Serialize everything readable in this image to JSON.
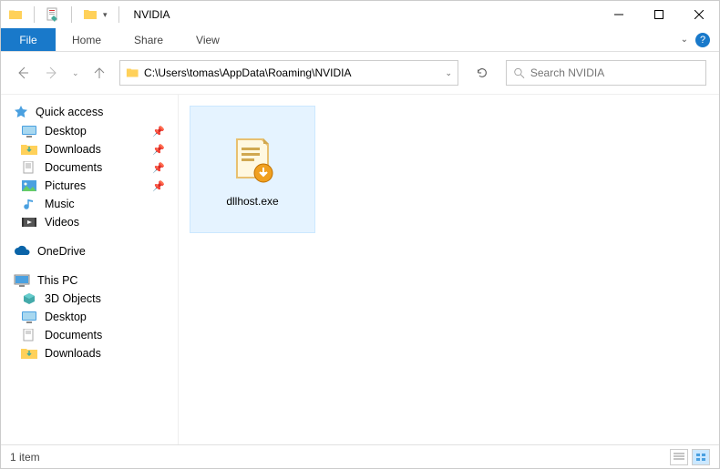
{
  "window": {
    "title": "NVIDIA"
  },
  "ribbon": {
    "file_tab": "File",
    "tabs": [
      "Home",
      "Share",
      "View"
    ]
  },
  "nav": {
    "address_path": "C:\\Users\\tomas\\AppData\\Roaming\\NVIDIA",
    "search_placeholder": "Search NVIDIA"
  },
  "sidebar": {
    "quick_access": {
      "label": "Quick access",
      "items": [
        {
          "label": "Desktop",
          "pinned": true,
          "icon": "desktop"
        },
        {
          "label": "Downloads",
          "pinned": true,
          "icon": "downloads"
        },
        {
          "label": "Documents",
          "pinned": true,
          "icon": "documents"
        },
        {
          "label": "Pictures",
          "pinned": true,
          "icon": "pictures"
        },
        {
          "label": "Music",
          "pinned": false,
          "icon": "music"
        },
        {
          "label": "Videos",
          "pinned": false,
          "icon": "videos"
        }
      ]
    },
    "onedrive": {
      "label": "OneDrive"
    },
    "this_pc": {
      "label": "This PC",
      "items": [
        {
          "label": "3D Objects",
          "icon": "3d"
        },
        {
          "label": "Desktop",
          "icon": "desktop"
        },
        {
          "label": "Documents",
          "icon": "documents"
        },
        {
          "label": "Downloads",
          "icon": "downloads"
        }
      ]
    }
  },
  "content": {
    "files": [
      {
        "name": "dllhost.exe"
      }
    ]
  },
  "status": {
    "text": "1 item"
  }
}
